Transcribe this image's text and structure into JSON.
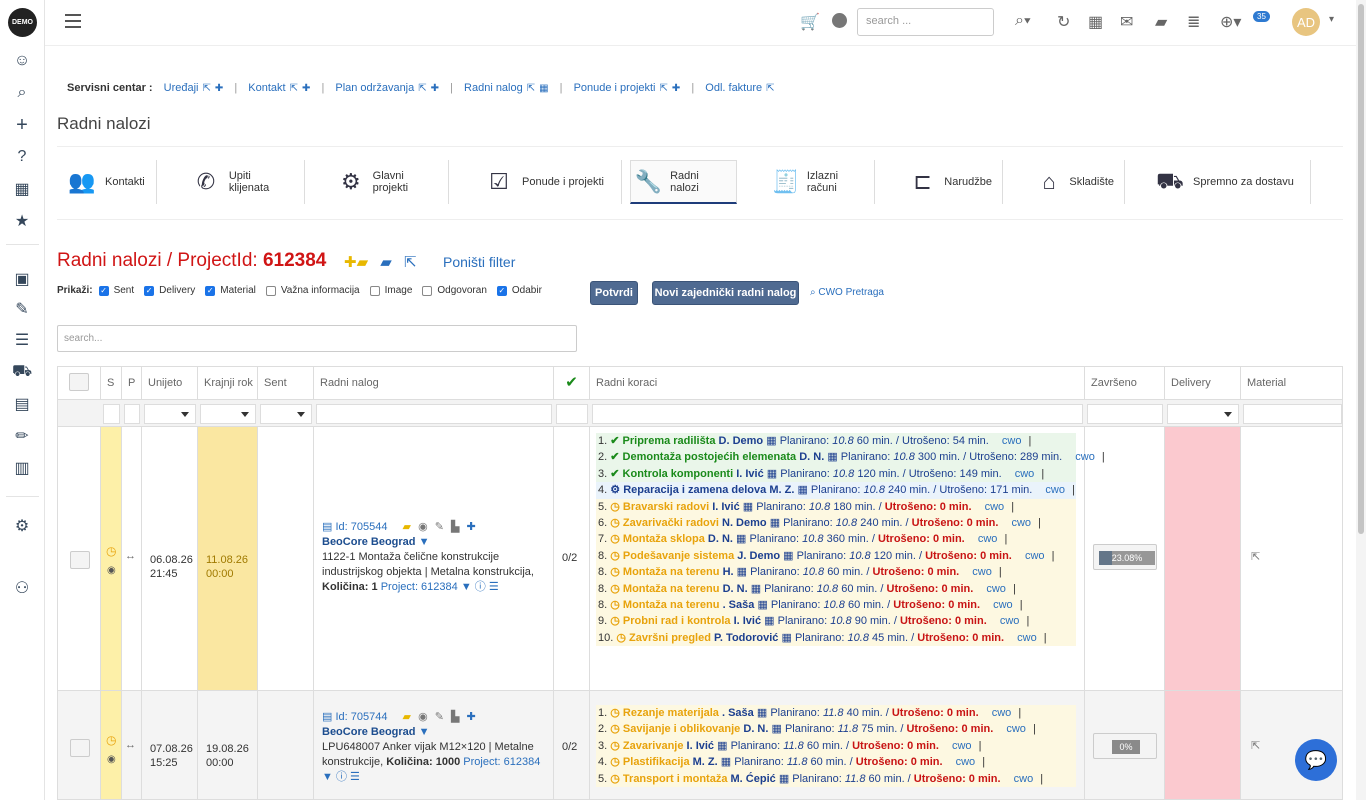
{
  "app": {
    "logo_text": "DEMO"
  },
  "topbar": {
    "search_placeholder": "search ...",
    "notification_count": "35",
    "avatar_initials": "AD"
  },
  "service_center": {
    "label": "Servisni centar :",
    "links": [
      "Uređaji",
      "Kontakt",
      "Plan održavanja",
      "Radni nalog",
      "Ponude i projekti",
      "Odl. fakture"
    ]
  },
  "page": {
    "title": "Radni nalozi"
  },
  "tabs": [
    {
      "label": "Kontakti",
      "icon": "contacts-icon"
    },
    {
      "label": "Upiti klijenata",
      "icon": "phone-mail-icon"
    },
    {
      "label": "Glavni projekti",
      "icon": "project-gear-icon"
    },
    {
      "label": "Ponude i projekti",
      "icon": "checklist-icon"
    },
    {
      "label": "Radni nalozi",
      "icon": "wrench-icon"
    },
    {
      "label": "Izlazni računi",
      "icon": "invoice-check-icon"
    },
    {
      "label": "Narudžbe",
      "icon": "dolly-icon"
    },
    {
      "label": "Skladište",
      "icon": "warehouse-icon"
    },
    {
      "label": "Spremno za dostavu",
      "icon": "truck-icon"
    }
  ],
  "heading": {
    "prefix": "Radni nalozi / ProjectId:",
    "project_id": "612384",
    "clear_filter": "Poništi filter"
  },
  "filters": {
    "label": "Prikaži:",
    "options": [
      {
        "label": "Sent",
        "checked": true
      },
      {
        "label": "Delivery",
        "checked": true
      },
      {
        "label": "Material",
        "checked": true
      },
      {
        "label": "Važna informacija",
        "checked": false
      },
      {
        "label": "Image",
        "checked": false
      },
      {
        "label": "Odgovoran",
        "checked": false
      },
      {
        "label": "Odabir",
        "checked": true
      }
    ],
    "confirm_button": "Potvrdi",
    "new_button": "Novi zajednički radni nalog",
    "cwo_search": "CWO Pretraga"
  },
  "grid": {
    "search_placeholder": "search...",
    "columns": [
      "",
      "S",
      "P",
      "Unijeto",
      "Krajnji rok",
      "Sent",
      "Radni nalog",
      "✔",
      "Radni koraci",
      "Završeno",
      "Delivery",
      "Material"
    ],
    "rows": [
      {
        "entered_date": "06.08.26",
        "entered_time": "21:45",
        "due_date": "11.08.26",
        "due_time": "00:00",
        "id": "Id: 705544",
        "company": "BeoCore Beograd",
        "desc": "1122-1 Montaža čelične konstrukcije industrijskog objekta | Metalna konstrukcija,",
        "qty_label": "Količina:",
        "qty": "1",
        "project": "Project: 612384",
        "ratio": "0/2",
        "progress": "23.08%",
        "progress_value": 23.08,
        "steps": [
          {
            "n": "1.",
            "status": "done",
            "name": "Priprema radilišta",
            "who": "D. Demo",
            "plan": "Planirano:",
            "pv": "10.8",
            "pm": "60 min. / Utrošeno: 54 min.",
            "cwo": "cwo"
          },
          {
            "n": "2.",
            "status": "done",
            "name": "Demontaža postojećih elemenata",
            "who": "D. N.",
            "plan": "Planirano:",
            "pv": "10.8",
            "pm": "300 min. / Utrošeno: 289 min.",
            "cwo": "cwo"
          },
          {
            "n": "3.",
            "status": "done",
            "name": "Kontrola komponenti",
            "who": "I. Ivić",
            "plan": "Planirano:",
            "pv": "10.8",
            "pm": "120 min. / Utrošeno: 149 min.",
            "cwo": "cwo"
          },
          {
            "n": "4.",
            "status": "work",
            "name": "Reparacija i zamena delova",
            "who": "M. Z.",
            "plan": "Planirano:",
            "pv": "10.8",
            "pm": "240 min. / Utrošeno: 171 min.",
            "cwo": "cwo"
          },
          {
            "n": "5.",
            "status": "todo",
            "name": "Bravarski radovi",
            "who": "I. Ivić",
            "plan": "Planirano:",
            "pv": "10.8",
            "pm": "180 min. /",
            "used": "Utrošeno: 0 min.",
            "cwo": "cwo"
          },
          {
            "n": "6.",
            "status": "todo",
            "name": "Zavarivački radovi",
            "who": "N. Demo",
            "plan": "Planirano:",
            "pv": "10.8",
            "pm": "240 min. /",
            "used": "Utrošeno: 0 min.",
            "cwo": "cwo"
          },
          {
            "n": "7.",
            "status": "todo",
            "name": "Montaža sklopa",
            "who": "D. N.",
            "plan": "Planirano:",
            "pv": "10.8",
            "pm": "360 min. /",
            "used": "Utrošeno: 0 min.",
            "cwo": "cwo"
          },
          {
            "n": "8.",
            "status": "todo",
            "name": "Podešavanje sistema",
            "who": "J. Demo",
            "plan": "Planirano:",
            "pv": "10.8",
            "pm": "120 min. /",
            "used": "Utrošeno: 0 min.",
            "cwo": "cwo"
          },
          {
            "n": "8.",
            "status": "todo",
            "name": "Montaža na terenu",
            "who": "H.",
            "plan": "Planirano:",
            "pv": "10.8",
            "pm": "60 min. /",
            "used": "Utrošeno: 0 min.",
            "cwo": "cwo"
          },
          {
            "n": "8.",
            "status": "todo",
            "name": "Montaža na terenu",
            "who": "D. N.",
            "plan": "Planirano:",
            "pv": "10.8",
            "pm": "60 min. /",
            "used": "Utrošeno: 0 min.",
            "cwo": "cwo"
          },
          {
            "n": "8.",
            "status": "todo",
            "name": "Montaža na terenu",
            "who": ". Saša",
            "plan": "Planirano:",
            "pv": "10.8",
            "pm": "60 min. /",
            "used": "Utrošeno: 0 min.",
            "cwo": "cwo"
          },
          {
            "n": "9.",
            "status": "todo",
            "name": "Probni rad i kontrola",
            "who": "I. Ivić",
            "plan": "Planirano:",
            "pv": "10.8",
            "pm": "90 min. /",
            "used": "Utrošeno: 0 min.",
            "cwo": "cwo"
          },
          {
            "n": "10.",
            "status": "todo",
            "name": "Završni pregled",
            "who": "P. Todorović",
            "plan": "Planirano:",
            "pv": "10.8",
            "pm": "45 min. /",
            "used": "Utrošeno: 0 min.",
            "cwo": "cwo"
          }
        ]
      },
      {
        "entered_date": "07.08.26",
        "entered_time": "15:25",
        "due_date": "19.08.26",
        "due_time": "00:00",
        "id": "Id: 705744",
        "company": "BeoCore Beograd",
        "desc": "LPU648007 Anker vijak M12×120 | Metalne konstrukcije,",
        "qty_label": "Količina:",
        "qty": "1000",
        "project": "Project: 612384",
        "ratio": "0/2",
        "progress": "0%",
        "progress_value": 0,
        "steps": [
          {
            "n": "1.",
            "status": "todo",
            "name": "Rezanje materijala",
            "who": ". Saša",
            "plan": "Planirano:",
            "pv": "11.8",
            "pm": "40 min. /",
            "used": "Utrošeno: 0 min.",
            "cwo": "cwo"
          },
          {
            "n": "2.",
            "status": "todo",
            "name": "Savijanje i oblikovanje",
            "who": "D. N.",
            "plan": "Planirano:",
            "pv": "11.8",
            "pm": "75 min. /",
            "used": "Utrošeno: 0 min.",
            "cwo": "cwo"
          },
          {
            "n": "3.",
            "status": "todo",
            "name": "Zavarivanje",
            "who": "I. Ivić",
            "plan": "Planirano:",
            "pv": "11.8",
            "pm": "60 min. /",
            "used": "Utrošeno: 0 min.",
            "cwo": "cwo"
          },
          {
            "n": "4.",
            "status": "todo",
            "name": "Plastifikacija",
            "who": "M. Z.",
            "plan": "Planirano:",
            "pv": "11.8",
            "pm": "60 min. /",
            "used": "Utrošeno: 0 min.",
            "cwo": "cwo"
          },
          {
            "n": "5.",
            "status": "todo",
            "name": "Transport i montaža",
            "who": "M. Ćepić",
            "plan": "Planirano:",
            "pv": "11.8",
            "pm": "60 min. /",
            "used": "Utrošeno: 0 min.",
            "cwo": "cwo"
          }
        ]
      }
    ]
  },
  "colors": {
    "accent": "#2a6fbd",
    "title_red": "#d01515",
    "due_yellow": "#fae7a1",
    "delivery_pink": "#fbc9cf",
    "s_col": "#fdf0a8"
  }
}
